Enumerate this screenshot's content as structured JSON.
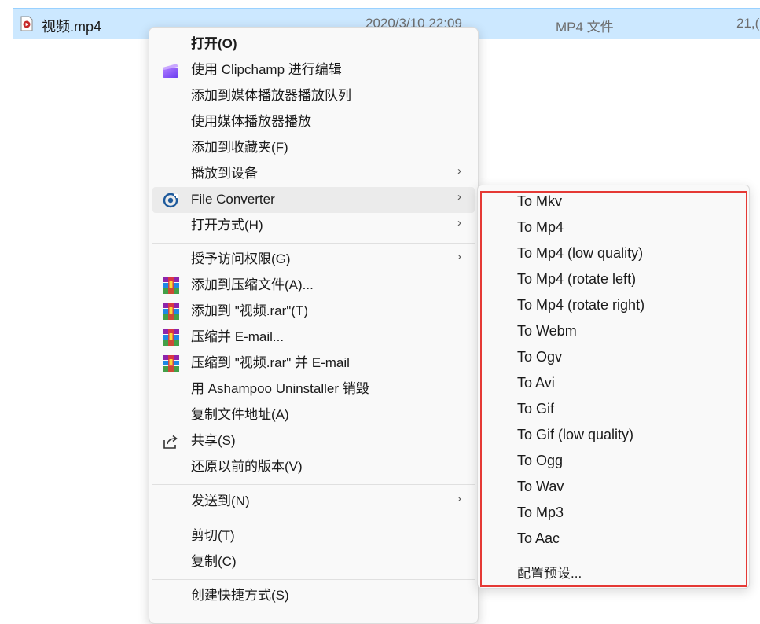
{
  "file_row": {
    "name": "视频.mp4",
    "date": "2020/3/10 22:09",
    "type": "MP4 文件",
    "size": "21,("
  },
  "menu": {
    "items": [
      {
        "label": "打开(O)",
        "icon": "none",
        "bold": true
      },
      {
        "label": "使用 Clipchamp 进行编辑",
        "icon": "clipchamp-icon"
      },
      {
        "label": "添加到媒体播放器播放队列",
        "icon": "none"
      },
      {
        "label": "使用媒体播放器播放",
        "icon": "none"
      },
      {
        "label": "添加到收藏夹(F)",
        "icon": "none"
      },
      {
        "label": "播放到设备",
        "icon": "none",
        "submenu": true
      },
      {
        "label": "File Converter",
        "icon": "file-converter-icon",
        "submenu": true
      },
      {
        "label": "打开方式(H)",
        "icon": "none",
        "submenu": true
      },
      {
        "label": "授予访问权限(G)",
        "icon": "none",
        "submenu": true
      },
      {
        "label": "添加到压缩文件(A)...",
        "icon": "winrar-icon"
      },
      {
        "label": "添加到 \"视频.rar\"(T)",
        "icon": "winrar-icon"
      },
      {
        "label": "压缩并 E-mail...",
        "icon": "winrar-icon"
      },
      {
        "label": "压缩到 \"视频.rar\" 并 E-mail",
        "icon": "winrar-icon"
      },
      {
        "label": "用 Ashampoo Uninstaller 销毁",
        "icon": "none"
      },
      {
        "label": "复制文件地址(A)",
        "icon": "none"
      },
      {
        "label": "共享(S)",
        "icon": "share-icon"
      },
      {
        "label": "还原以前的版本(V)",
        "icon": "none"
      },
      {
        "label": "发送到(N)",
        "icon": "none",
        "submenu": true
      },
      {
        "label": "剪切(T)",
        "icon": "none"
      },
      {
        "label": "复制(C)",
        "icon": "none"
      },
      {
        "label": "创建快捷方式(S)",
        "icon": "none"
      }
    ],
    "arrow": "›"
  },
  "submenu": {
    "items": [
      "To Mkv",
      "To Mp4",
      "To Mp4 (low quality)",
      "To Mp4 (rotate left)",
      "To Mp4 (rotate right)",
      "To Webm",
      "To Ogv",
      "To Avi",
      "To Gif",
      "To Gif (low quality)",
      "To Ogg",
      "To Wav",
      "To Mp3",
      "To Aac"
    ],
    "settings_label": "配置预设..."
  },
  "colors": {
    "selection": "#cce8ff",
    "highlight_border": "#e53935",
    "menu_bg": "#f9f9f9"
  }
}
